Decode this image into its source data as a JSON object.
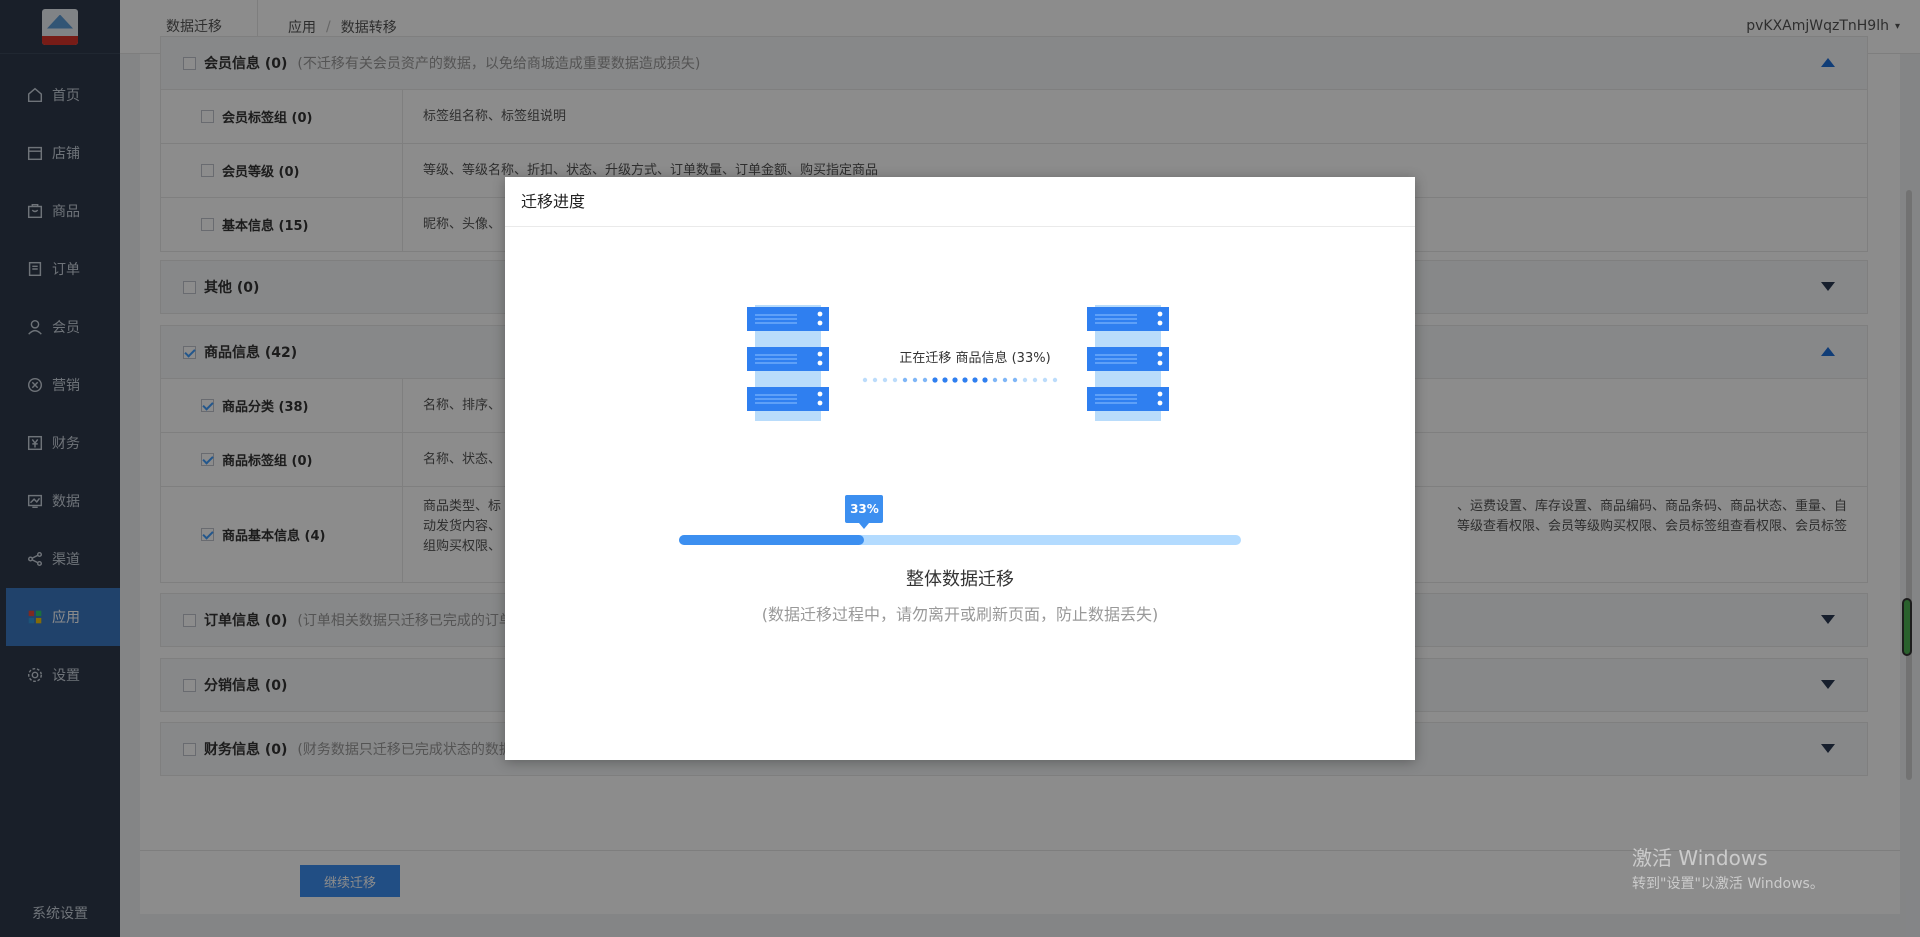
{
  "sidebar": {
    "items": [
      {
        "label": "首页",
        "icon": "home-icon"
      },
      {
        "label": "店铺",
        "icon": "store-icon"
      },
      {
        "label": "商品",
        "icon": "goods-icon"
      },
      {
        "label": "订单",
        "icon": "order-icon"
      },
      {
        "label": "会员",
        "icon": "member-icon"
      },
      {
        "label": "营销",
        "icon": "marketing-icon"
      },
      {
        "label": "财务",
        "icon": "finance-icon"
      },
      {
        "label": "数据",
        "icon": "data-icon"
      },
      {
        "label": "渠道",
        "icon": "channel-icon"
      },
      {
        "label": "应用",
        "icon": "apps-icon"
      },
      {
        "label": "设置",
        "icon": "settings-icon"
      }
    ],
    "active": "应用",
    "footer": "系统设置"
  },
  "topbar": {
    "title": "数据迁移",
    "breadcrumb": [
      "应用",
      "数据转移"
    ],
    "user": "pvKXAmjWqzTnH9lh"
  },
  "sections": {
    "member": {
      "title": "会员信息 (0)",
      "note": "(不迁移有关会员资产的数据，以免给商城造成重要数据造成损失)",
      "rows": [
        {
          "label": "会员标签组 (0)",
          "desc": "标签组名称、标签组说明"
        },
        {
          "label": "会员等级 (0)",
          "desc": "等级、等级名称、折扣、状态、升级方式、订单数量、订单金额、购买指定商品"
        },
        {
          "label": "基本信息 (15)",
          "desc": "昵称、头像、"
        }
      ]
    },
    "other": {
      "title": "其他 (0)"
    },
    "goods": {
      "title": "商品信息 (42)",
      "rows": [
        {
          "label": "商品分类 (38)",
          "desc": "名称、排序、"
        },
        {
          "label": "商品标签组 (0)",
          "desc": "名称、状态、"
        },
        {
          "label": "商品基本信息 (4)",
          "desc_left": "商品类型、标",
          "desc_left2": "动发货内容、",
          "desc_left3": "组购买权限、",
          "desc_right": "、运费设置、库存设置、商品编码、商品条码、商品状态、重量、自",
          "desc_right2": "等级查看权限、会员等级购买权限、会员标签组查看权限、会员标签"
        }
      ]
    },
    "order": {
      "title": "订单信息 (0)",
      "note": "(订单相关数据只迁移已完成的订单"
    },
    "distribution": {
      "title": "分销信息 (0)"
    },
    "finance": {
      "title": "财务信息 (0)",
      "note": "(财务数据只迁移已完成状态的数据"
    }
  },
  "footer": {
    "continue_label": "继续迁移"
  },
  "watermark": {
    "line1": "激活 Windows",
    "line2": "转到\"设置\"以激活 Windows。"
  },
  "modal": {
    "title": "迁移进度",
    "status": "正在迁移 商品信息 (33%)",
    "progress_percent": 33,
    "progress_label": "33%",
    "main_label": "整体数据迁移",
    "sub_label": "(数据迁移过程中，请勿离开或刷新页面，防止数据丢失)",
    "colors": {
      "accent": "#3c8ff0",
      "track": "#b3dbff"
    }
  }
}
